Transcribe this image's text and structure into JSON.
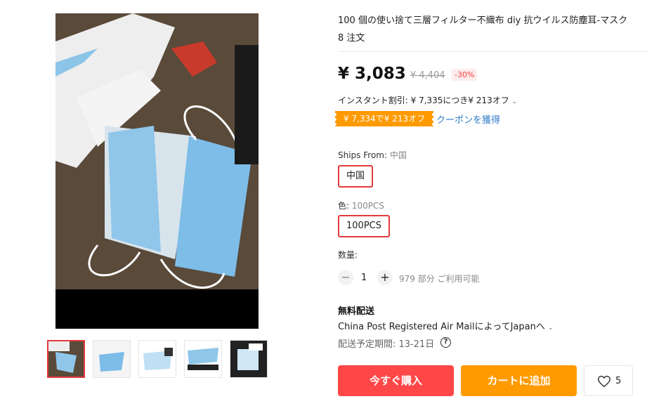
{
  "product": {
    "title": "100 個の使い捨て三層フィルター不織布 diy 抗ウイルス防塵耳-マスク",
    "orders": "8 注文"
  },
  "pricing": {
    "price": "¥ 3,083",
    "original_price": "¥ 4,404",
    "discount": "-30%",
    "instant_discount": "インスタント割引: ¥ 7,335につき¥ 213オフ",
    "coupon_tag": "¥ 7,334で¥ 213オフ",
    "coupon_link": "クーポンを獲得"
  },
  "ships_from": {
    "label": "Ships From:",
    "selected": "中国",
    "option": "中国"
  },
  "color": {
    "label": "色:",
    "selected": "100PCS",
    "option": "100PCS"
  },
  "quantity": {
    "label": "数量:",
    "minus": "−",
    "plus": "+",
    "value": "1",
    "available": "979 部分 ご利用可能"
  },
  "shipping": {
    "free": "無料配送",
    "method": "China Post Registered Air MailによってJapanへ",
    "eta": "配送予定期間: 13-21日"
  },
  "actions": {
    "buy_now": "今すぐ購入",
    "add_to_cart": "カートに追加",
    "wishlist_count": "5"
  },
  "colors": {
    "buy": "#ff4747",
    "cart": "#ff9a00",
    "accent_red": "#e4393c",
    "link": "#2e7cc7"
  }
}
